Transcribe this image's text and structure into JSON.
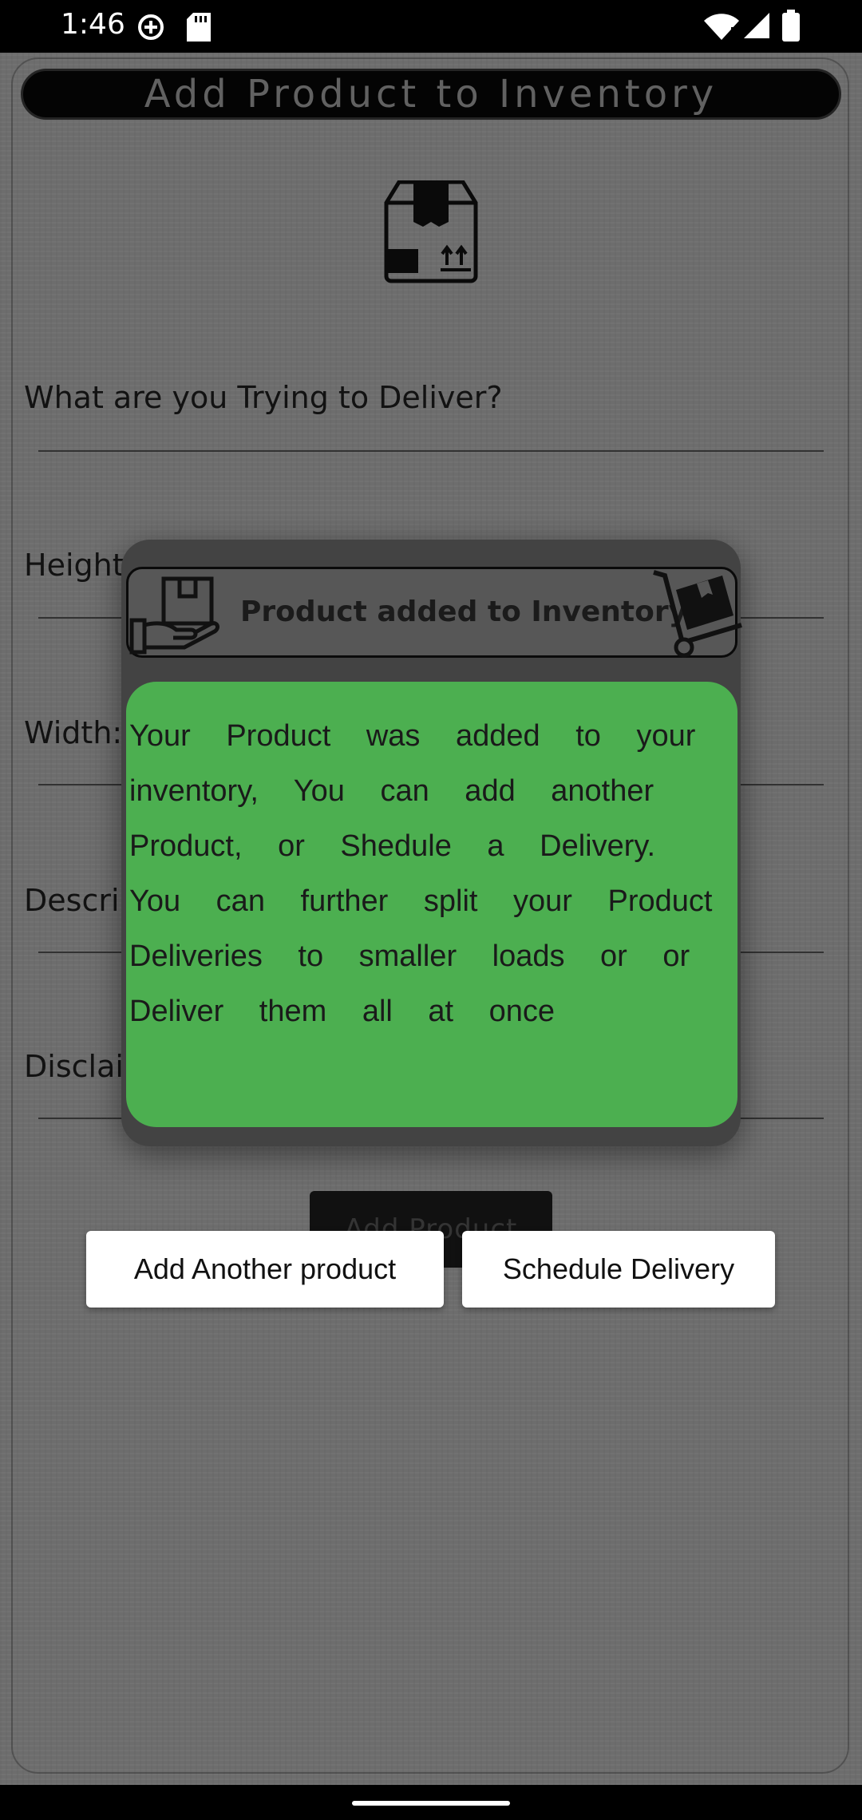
{
  "status_bar": {
    "time": "1:46"
  },
  "header": {
    "title": "Add Product to Inventory"
  },
  "form": {
    "fields": [
      {
        "label": "What are you Trying to Deliver?"
      },
      {
        "label": "Height:"
      },
      {
        "label": "Width:"
      },
      {
        "label": "Descri"
      },
      {
        "label": "Disclai"
      }
    ],
    "submit_label": "Add Product"
  },
  "dialog": {
    "title": "Product added to Inventory",
    "message": "Your Product was added to your inventory, You can add another Product, or Shedule a Delivery. You can further split your Product Deliveries to smaller loads or or Deliver them all at once",
    "colors": {
      "body": "#4caf50",
      "header": "#575757",
      "panel": "#434343"
    }
  },
  "actions": {
    "add_another": "Add Another product",
    "schedule": "Schedule Delivery"
  }
}
